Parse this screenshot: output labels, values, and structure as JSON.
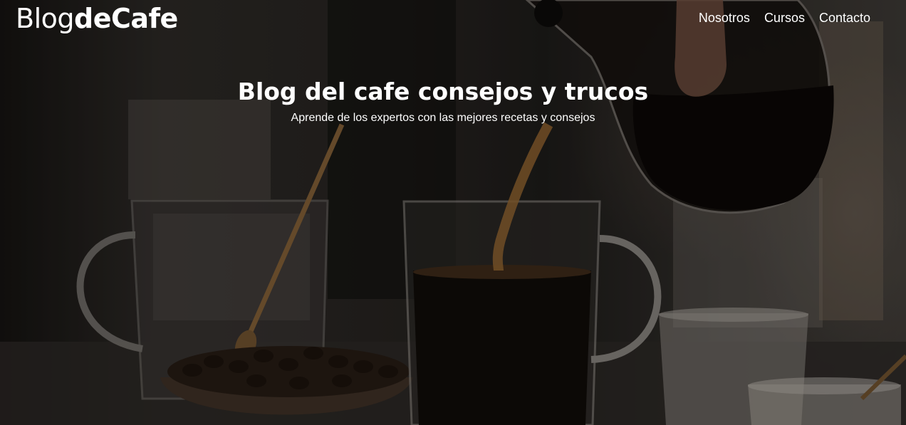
{
  "header": {
    "logo_light": "Blog",
    "logo_bold": "deCafe",
    "nav": [
      {
        "label": "Nosotros"
      },
      {
        "label": "Cursos"
      },
      {
        "label": "Contacto"
      }
    ]
  },
  "hero": {
    "title": "Blog del cafe consejos y trucos",
    "subtitle": "Aprende de los expertos con las mejores recetas y consejos"
  }
}
